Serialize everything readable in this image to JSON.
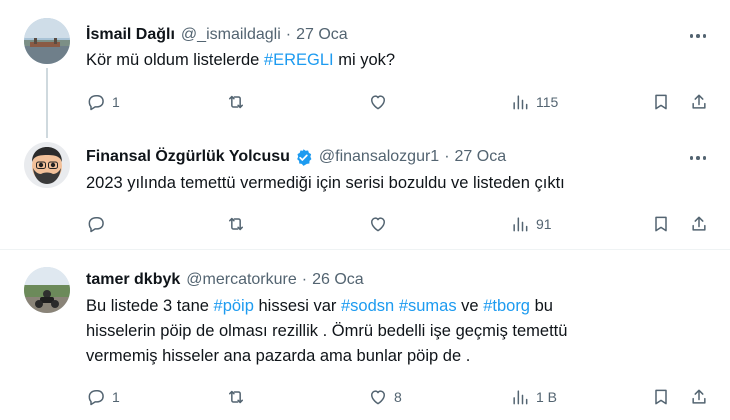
{
  "tweets": [
    {
      "name": "İsmail Dağlı",
      "handle": "@_ismaildagli",
      "dot": "·",
      "date": "27 Oca",
      "text": [
        {
          "t": "Kör mü oldum listelerde ",
          "link": false
        },
        {
          "t": "#EREGLI",
          "link": true
        },
        {
          "t": " mi yok?",
          "link": false
        }
      ],
      "replies": "1",
      "retweets": "",
      "likes": "",
      "views": "115"
    },
    {
      "name": "Finansal Özgürlük Yolcusu",
      "handle": "@finansalozgur1",
      "dot": "·",
      "date": "27 Oca",
      "verified": true,
      "text": [
        {
          "t": "2023 yılında temettü vermediği için serisi bozuldu ve listeden çıktı",
          "link": false
        }
      ],
      "replies": "",
      "retweets": "",
      "likes": "",
      "views": "91"
    },
    {
      "name": "tamer dkbyk",
      "handle": "@mercatorkure",
      "dot": "·",
      "date": "26 Oca",
      "lines": [
        [
          {
            "t": "Bu listede 3 tane ",
            "link": false
          },
          {
            "t": "#pöip",
            "link": true
          },
          {
            "t": "  hissesi var ",
            "link": false
          },
          {
            "t": "#sodsn",
            "link": true
          },
          {
            "t": " ",
            "link": false
          },
          {
            "t": "#sumas",
            "link": true
          },
          {
            "t": " ve ",
            "link": false
          },
          {
            "t": "#tborg",
            "link": true
          },
          {
            "t": "  bu",
            "link": false
          }
        ],
        [
          {
            "t": "hisselerin pöip de olması rezillik .  Ömrü bedelli işe geçmiş  temettü",
            "link": false
          }
        ],
        [
          {
            "t": "vermemiş hisseler ana pazarda ama  bunlar pöip de .",
            "link": false
          }
        ]
      ],
      "replies": "1",
      "retweets": "",
      "likes": "8",
      "views": "1 B"
    }
  ],
  "colors": {
    "link": "#1d9bf0",
    "muted": "#536471",
    "verified": "#1d9bf0",
    "divider": "#eff3f4",
    "thread_line": "#cfd9de"
  },
  "icons": [
    "reply-icon",
    "retweet-icon",
    "like-icon",
    "views-icon",
    "bookmark-icon",
    "share-icon",
    "more-icon",
    "verified-badge-icon"
  ]
}
